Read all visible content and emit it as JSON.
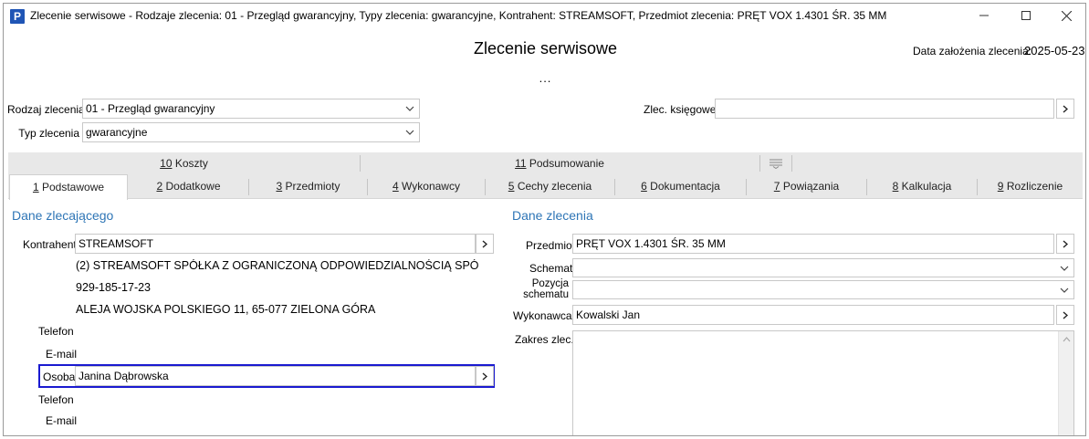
{
  "window": {
    "app_icon": "P",
    "title": "Zlecenie serwisowe - Rodzaje zlecenia: 01 - Przegląd gwarancyjny, Typy zlecenia: gwarancyjne, Kontrahent: STREAMSOFT, Przedmiot zlecenia: PRĘT VOX 1.4301 ŚR. 35 MM"
  },
  "header": {
    "title": "Zlecenie serwisowe",
    "date_label": "Data założenia zlecenia:",
    "date_value": "2025-05-23",
    "ellipsis": "..."
  },
  "form": {
    "rodzaj_label": "Rodzaj zlecenia",
    "rodzaj_value": "01 - Przegląd gwarancyjny",
    "typ_label": "Typ zlecenia",
    "typ_value": "gwarancyjne",
    "zlec_ksiegowe_label": "Zlec. księgowe",
    "zlec_ksiegowe_value": ""
  },
  "tabs_row1": [
    {
      "num": "10",
      "label": " Koszty"
    },
    {
      "num": "11",
      "label": " Podsumowanie"
    }
  ],
  "tabs_row2": [
    {
      "num": "1",
      "label": " Podstawowe"
    },
    {
      "num": "2",
      "label": " Dodatkowe"
    },
    {
      "num": "3",
      "label": " Przedmioty"
    },
    {
      "num": "4",
      "label": " Wykonawcy"
    },
    {
      "num": "5",
      "label": " Cechy zlecenia"
    },
    {
      "num": "6",
      "label": " Dokumentacja"
    },
    {
      "num": "7",
      "label": " Powiązania"
    },
    {
      "num": "8",
      "label": " Kalkulacja"
    },
    {
      "num": "9",
      "label": " Rozliczenie"
    }
  ],
  "left": {
    "section_title": "Dane zlecającego",
    "kontrahent_label": "Kontrahent",
    "kontrahent_value": "STREAMSOFT",
    "full_name": "(2) STREAMSOFT SPÓŁKA Z OGRANICZONĄ ODPOWIEDZIALNOŚCIĄ SPÓ",
    "nip": "929-185-17-23",
    "address": "ALEJA WOJSKA POLSKIEGO 11, 65-077 ZIELONA GÓRA",
    "telefon_label": "Telefon",
    "email_label": "E-mail",
    "osoba_label": "Osoba",
    "osoba_value": "Janina Dąbrowska",
    "telefon2_label": "Telefon",
    "email2_label": "E-mail"
  },
  "right": {
    "section_title": "Dane zlecenia",
    "przedmiot_label": "Przedmiot",
    "przedmiot_value": "PRĘT VOX 1.4301 ŚR. 35 MM",
    "schemat_label": "Schemat",
    "schemat_value": "",
    "pozycja_label_1": "Pozycja",
    "pozycja_label_2": "schematu",
    "pozycja_value": "",
    "wykonawca_label": "Wykonawca",
    "wykonawca_value": "Kowalski Jan",
    "zakres_label": "Zakres zlec."
  },
  "colors": {
    "accent": "#2e75b6",
    "focus": "#1a1ad0",
    "tab_bg": "#e8e8e8"
  }
}
